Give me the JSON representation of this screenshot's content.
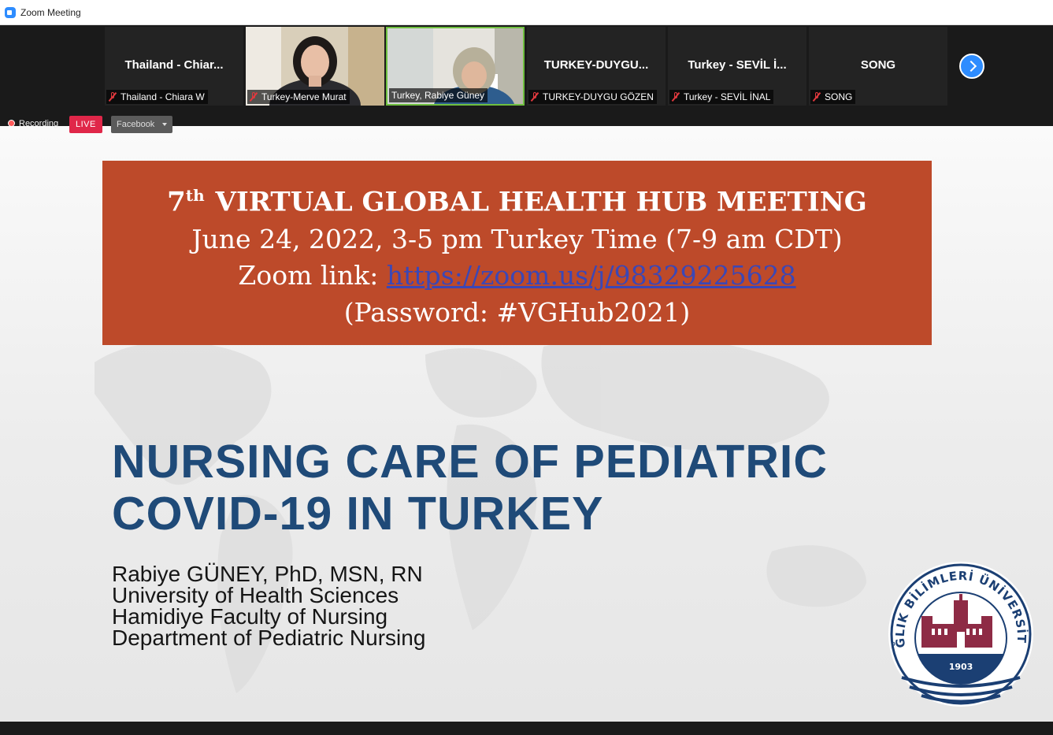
{
  "window": {
    "title": "Zoom Meeting"
  },
  "participants": [
    {
      "display": "Thailand - Chiar...",
      "name": "Thailand - Chiara W",
      "muted": true,
      "video": false
    },
    {
      "display": "",
      "name": "Turkey-Merve Murat",
      "muted": true,
      "video": true
    },
    {
      "display": "",
      "name": "Turkey, Rabiye Güney",
      "muted": false,
      "video": true,
      "active_speaker": true
    },
    {
      "display": "TURKEY-DUYGU...",
      "name": "TURKEY-DUYGU GÖZEN",
      "muted": true,
      "video": false
    },
    {
      "display": "Turkey - SEVİL İ...",
      "name": "Turkey - SEVİL İNAL",
      "muted": true,
      "video": false
    },
    {
      "display": "SONG",
      "name": "SONG",
      "muted": true,
      "video": false
    }
  ],
  "status": {
    "recording": "Recording",
    "live": "LIVE",
    "stream_target": "Facebook"
  },
  "slide": {
    "banner": {
      "ordinal": "7",
      "ordinal_suffix": "th",
      "heading": "VIRTUAL GLOBAL HEALTH HUB MEETING",
      "date_line": "June 24, 2022, 3-5 pm Turkey Time (7-9 am CDT)",
      "zoom_label": "Zoom link:",
      "zoom_url": "https://zoom.us/j/98329225628",
      "password_line": "(Password: #VGHub2021)"
    },
    "title_line1": "NURSING CARE OF PEDIATRIC",
    "title_line2": "COVID-19 IN TURKEY",
    "author_lines": [
      "Rabiye GÜNEY, PhD, MSN, RN",
      "University of Health Sciences",
      "Hamidiye Faculty of Nursing",
      "Department of Pediatric Nursing"
    ],
    "logo": {
      "text": "SAĞLIK BİLİMLERİ ÜNİVERSİTESİ",
      "year": "1903"
    }
  },
  "colors": {
    "banner_bg": "#bd4a2a",
    "title": "#1f4a78",
    "accent": "#2d8cff",
    "live": "#e02749"
  }
}
